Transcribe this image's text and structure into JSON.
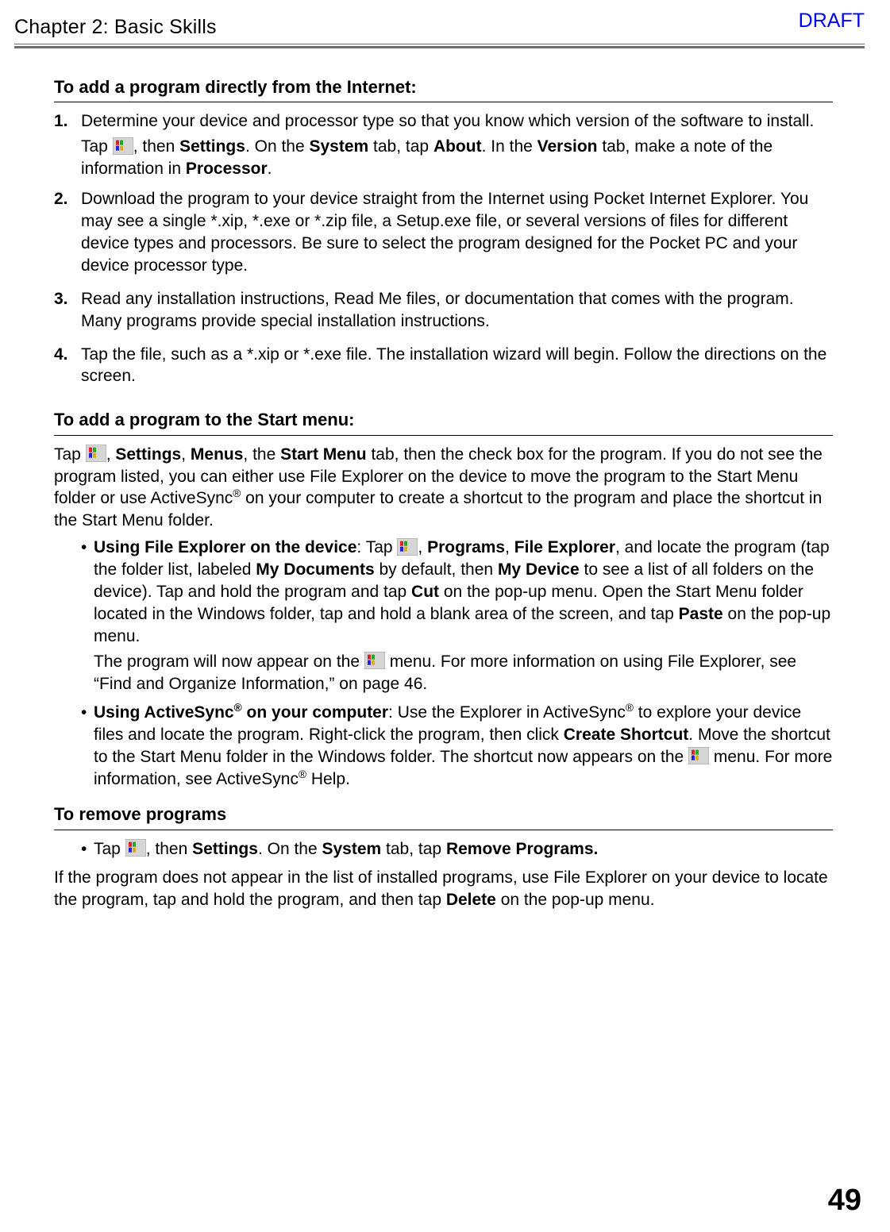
{
  "header": {
    "chapter": "Chapter 2: Basic Skills",
    "draft": "DRAFT"
  },
  "sec1": {
    "heading": "To add a program directly from the Internet:",
    "steps": [
      {
        "n": "1.",
        "p1": "Determine your device and processor type so that you know which version of the software to install.",
        "p2a": "Tap ",
        "p2b": ", then ",
        "settings": "Settings",
        "p2c": ". On the ",
        "system": "System",
        "p2d": " tab, tap ",
        "about": "About",
        "p2e": ". In the ",
        "version": "Version",
        "p2f": " tab, make a note of the information in ",
        "processor": "Processor",
        "p2g": "."
      },
      {
        "n": "2.",
        "p1": "Download the program to your device straight from the Internet using Pocket Internet Explorer. You may see a single *.xip, *.exe or *.zip file, a Setup.exe file, or several versions of files for different device types and processors. Be sure to select the program designed for the Pocket PC and your device processor type."
      },
      {
        "n": "3.",
        "p1": "Read any installation instructions, Read Me files, or documentation that comes with the program. Many programs provide special installation instructions."
      },
      {
        "n": "4.",
        "p1": "Tap the file, such as a *.xip or *.exe file. The installation wizard will begin. Follow the directions on the screen."
      }
    ]
  },
  "sec2": {
    "heading": "To add a program to the Start menu:",
    "intro_a": "Tap ",
    "intro_b": ", ",
    "settings": "Settings",
    "intro_c": ", ",
    "menus": "Menus",
    "intro_d": ", the ",
    "startmenu": "Start Menu",
    "intro_e": " tab, then the check box for the program. If you do not see the program listed, you can either use File Explorer on the device to move the program to the Start Menu folder or use ActiveSync",
    "intro_f": " on your computer to create a shortcut to the program and place the shortcut in the Start Menu folder.",
    "b1": {
      "lead": "Using File Explorer on the device",
      "a": ": Tap ",
      "b": ", ",
      "programs": "Programs",
      "c": ", ",
      "fileexp": "File Explorer",
      "d": ", and locate the program (tap the folder list, labeled ",
      "mydocs": "My Documents",
      "e": " by default, then ",
      "mydev": "My Device",
      "f": " to see a list of all folders on the device). Tap and hold the program and tap ",
      "cut": "Cut",
      "g": " on the pop-up menu. Open the Start Menu folder located in the Windows folder, tap and hold a blank area of the screen, and tap ",
      "paste": "Paste",
      "h": " on the pop-up menu.",
      "p2a": "The program will now appear on the ",
      "p2b": " menu. For more information on using File Explorer, see “Find and Organize Information,” on page 46."
    },
    "b2": {
      "lead": "Using ActiveSync",
      "lead2": " on your computer",
      "a": ": Use the Explorer in ActiveSync",
      "b": " to explore your device files and locate the program. Right-click the program, then click ",
      "create": "Create Shortcut",
      "c": ". Move the shortcut to the Start Menu folder in the Windows folder. The shortcut now appears on the ",
      "d": " menu. For more information, see ActiveSync",
      "e": " Help."
    }
  },
  "sec3": {
    "heading": "To remove programs",
    "bullet_a": "Tap ",
    "bullet_b": ", then ",
    "settings": "Settings",
    "bullet_c": ". On the ",
    "system": "System",
    "bullet_d": " tab, tap ",
    "remove": "Remove Programs.",
    "after_a": "If the program does not appear in the list of installed programs, use File Explorer on your device to locate the program, tap and hold the program, and then tap ",
    "delete": "Delete",
    "after_b": " on the pop-up menu."
  },
  "page_number": "49",
  "reg": "®"
}
